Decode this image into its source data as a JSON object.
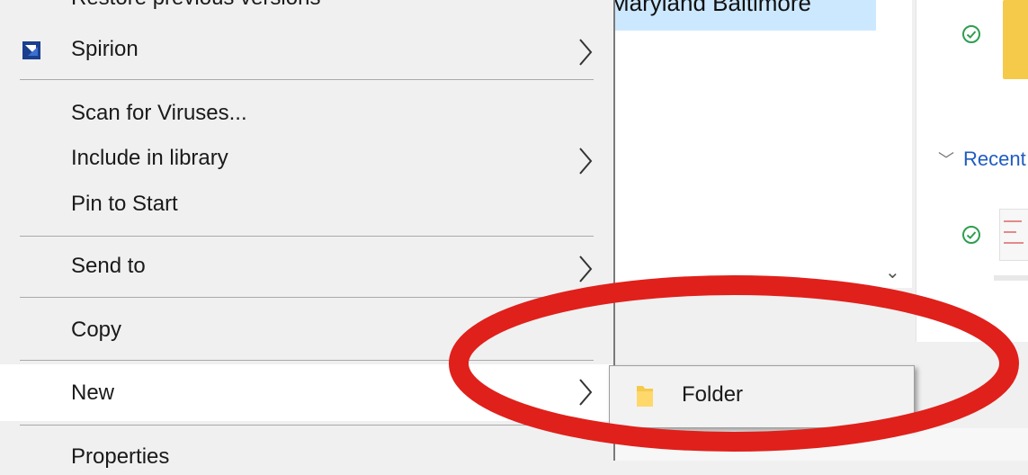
{
  "context_menu": {
    "items": [
      {
        "label": "Restore previous versions"
      },
      {
        "label": "Spirion",
        "icon": "spirion-icon"
      },
      {
        "label": "Scan for Viruses..."
      },
      {
        "label": "Include in library"
      },
      {
        "label": "Pin to Start"
      },
      {
        "label": "Send to"
      },
      {
        "label": "Copy"
      },
      {
        "label": "New"
      },
      {
        "label": "Properties"
      }
    ]
  },
  "submenu": {
    "items": [
      {
        "label": "Folder",
        "icon": "folder-icon"
      }
    ]
  },
  "explorer": {
    "selected_item": "Maryland Baltimore",
    "section_title": "Recent"
  },
  "colors": {
    "highlight": "#cce8ff",
    "annotation": "#e0201b",
    "link": "#1f5cc1",
    "check": "#2e9e4f",
    "folder": "#f5c94a"
  }
}
